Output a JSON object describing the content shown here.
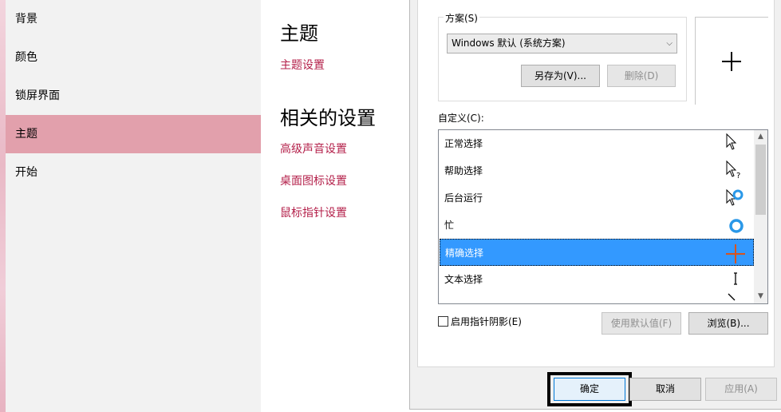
{
  "settings": {
    "nav_items": [
      {
        "label": "背景"
      },
      {
        "label": "颜色"
      },
      {
        "label": "锁屏界面"
      },
      {
        "label": "主题",
        "active": true
      },
      {
        "label": "开始"
      }
    ],
    "page_title": "主题",
    "theme_settings_link": "主题设置",
    "related_heading": "相关的设置",
    "related_links": [
      "高级声音设置",
      "桌面图标设置",
      "鼠标指针设置"
    ],
    "accent_color": "#b4214b",
    "active_nav_color": "#e2a0ac"
  },
  "dialog": {
    "scheme": {
      "legend": "方案(S)",
      "selected": "Windows 默认 (系统方案)",
      "save_as_label": "另存为(V)...",
      "delete_label": "删除(D)"
    },
    "customize_label": "自定义(C):",
    "cursor_list": [
      {
        "label": "正常选择",
        "icon": "arrow-cursor-icon"
      },
      {
        "label": "帮助选择",
        "icon": "help-cursor-icon"
      },
      {
        "label": "后台运行",
        "icon": "working-in-background-cursor-icon"
      },
      {
        "label": "忙",
        "icon": "busy-cursor-icon"
      },
      {
        "label": "精确选择",
        "icon": "precision-cross-cursor-icon",
        "selected": true
      },
      {
        "label": "文本选择",
        "icon": "text-ibeam-cursor-icon"
      }
    ],
    "shadow_checkbox": {
      "label": "启用指针阴影(E)",
      "checked": false
    },
    "use_default_label": "使用默认值(F)",
    "browse_label": "浏览(B)...",
    "ok_label": "确定",
    "cancel_label": "取消",
    "apply_label": "应用(A)",
    "selection_color": "#3399ff"
  }
}
